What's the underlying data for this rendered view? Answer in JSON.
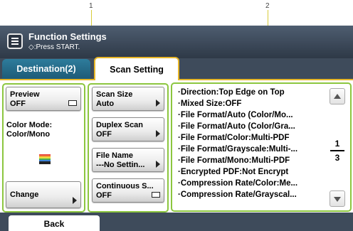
{
  "callouts": [
    "1",
    "2"
  ],
  "header": {
    "title": "Function Settings",
    "subtitle": "◇:Press START."
  },
  "tabs": [
    {
      "label": "Destination(2)"
    },
    {
      "label": "Scan Setting"
    }
  ],
  "left_group": {
    "preview": {
      "label": "Preview",
      "value": "OFF"
    },
    "color_mode_label": "Color Mode:",
    "color_mode_value": "Color/Mono",
    "change_label": "Change"
  },
  "mid_group": {
    "scan_size": {
      "label": "Scan Size",
      "value": "Auto"
    },
    "duplex_scan": {
      "label": "Duplex Scan",
      "value": "OFF"
    },
    "file_name": {
      "label": "File Name",
      "value": "---No Settin..."
    },
    "continuous_scan": {
      "label": "Continuous S...",
      "value": "OFF"
    }
  },
  "settings_list": [
    "·Direction:Top Edge on Top",
    "·Mixed Size:OFF",
    "·File Format/Auto (Color/Mo...",
    "·File Format/Auto (Color/Gra...",
    "·File Format/Color:Multi-PDF",
    "·File Format/Grayscale:Multi-...",
    "·File Format/Mono:Multi-PDF",
    "·Encrypted PDF:Not Encrypt",
    "·Compression Rate/Color:Me...",
    "·Compression Rate/Grayscal..."
  ],
  "pager": {
    "current": "1",
    "total": "3"
  },
  "footer": {
    "back_label": "Back"
  },
  "colors": {
    "accent_tab": "#e7b628",
    "group_border": "#8cc63f",
    "header": "#3e4b5b"
  }
}
